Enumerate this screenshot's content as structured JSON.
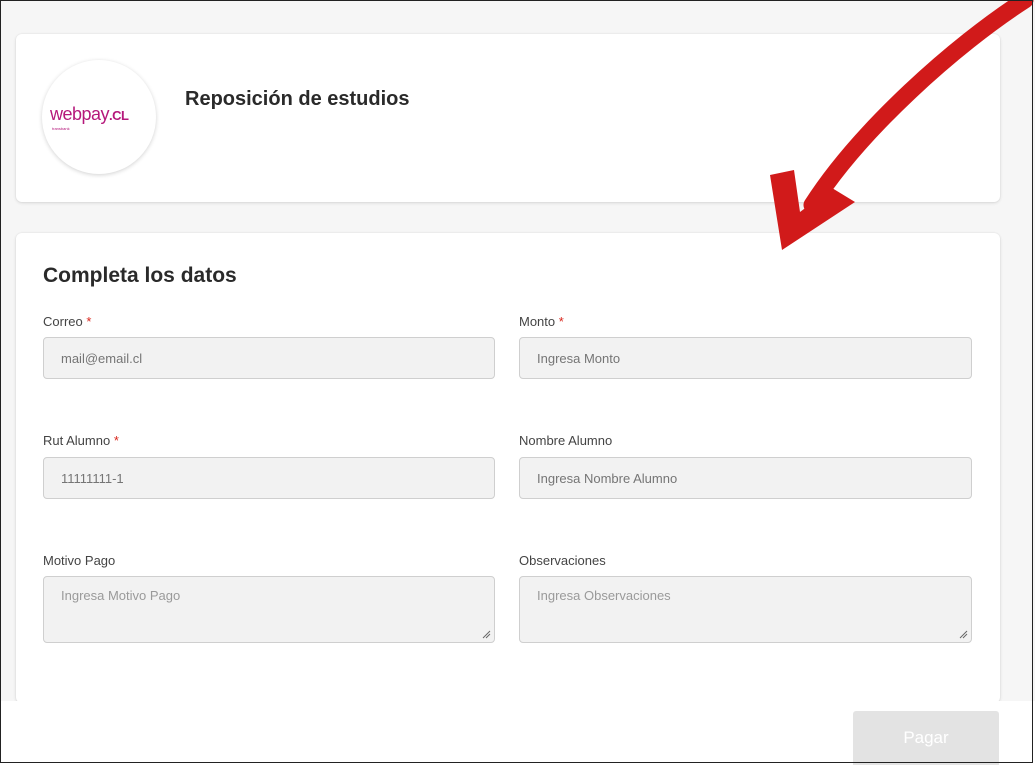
{
  "header": {
    "logo_brand": "webpay",
    "logo_tld": ".CL",
    "logo_sub": "transbank",
    "title": "Reposición de estudios"
  },
  "form": {
    "title": "Completa los datos",
    "fields": {
      "correo": {
        "label": "Correo",
        "required": "*",
        "placeholder": "mail@email.cl"
      },
      "monto": {
        "label": "Monto",
        "required": "*",
        "placeholder": "Ingresa Monto"
      },
      "rut": {
        "label": "Rut Alumno",
        "required": "*",
        "placeholder": "11111111-1"
      },
      "nombre": {
        "label": "Nombre Alumno",
        "placeholder": "Ingresa Nombre Alumno"
      },
      "motivo": {
        "label": "Motivo Pago",
        "placeholder": "Ingresa Motivo Pago"
      },
      "observaciones": {
        "label": "Observaciones",
        "placeholder": "Ingresa Observaciones"
      }
    }
  },
  "actions": {
    "pay_label": "Pagar"
  },
  "colors": {
    "brand": "#b5187b",
    "required": "#d9261c",
    "annotation_arrow": "#d11a1a",
    "button_disabled": "#e3e3e3"
  },
  "icons": {
    "annotation": "red-arrow-icon",
    "logo": "webpay-logo-icon"
  }
}
